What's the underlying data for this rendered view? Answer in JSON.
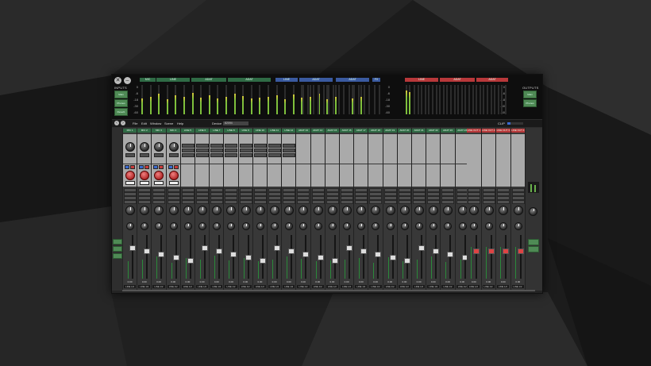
{
  "window": {
    "close_icon": "close-icon",
    "minimize_icon": "minimize-icon",
    "inputs_label": "INPUTS",
    "outputs_label": "OUTPUTS",
    "input_buttons": [
      "Main",
      "Phones",
      "Reverb"
    ],
    "output_buttons": [
      "Main",
      "Phones"
    ]
  },
  "meter_groups": {
    "inputs": [
      {
        "label": "MIC",
        "color": "#2f6b45"
      },
      {
        "label": "LINE",
        "color": "#2f6b45"
      },
      {
        "label": "ADAT",
        "color": "#2f6b45"
      },
      {
        "label": "ADAT",
        "color": "#2f6b45"
      },
      {
        "label": "LINE",
        "color": "#3a5aa0"
      },
      {
        "label": "ADAT",
        "color": "#3a5aa0"
      },
      {
        "label": "ADAT",
        "color": "#3a5aa0"
      },
      {
        "label": "FX",
        "color": "#3a5aa0"
      }
    ],
    "outputs": [
      {
        "label": "LINE",
        "color": "#b8383a"
      },
      {
        "label": "ADAT",
        "color": "#b8383a"
      },
      {
        "label": "ADAT",
        "color": "#b8383a"
      }
    ],
    "scale": [
      "0",
      "-6",
      "-18",
      "-30",
      "-60"
    ]
  },
  "menu": {
    "items": [
      "File",
      "Edit",
      "Window",
      "Scene",
      "Help"
    ],
    "device_label": "Device",
    "device_value": "82094",
    "clip_label": "CLIP"
  },
  "channels": {
    "inputs": [
      "MIC 1",
      "MIC 2",
      "MIC 3",
      "MIC 4",
      "LINE 5",
      "LINE 6",
      "LINE 7",
      "LINE 8",
      "LINE 9",
      "LINE 10",
      "LINE 11",
      "LINE 12",
      "ADAT 13",
      "ADAT 14",
      "ADAT 15",
      "ADAT 16",
      "ADAT 17",
      "ADAT 18",
      "ADAT 19",
      "ADAT 20",
      "ADAT 21",
      "ADAT 22",
      "ADAT 23",
      "ADAT 24"
    ],
    "outputs": [
      "LINE OUT 1",
      "LINE OUT 2",
      "LINE OUT 3",
      "LINE OUT 4"
    ],
    "input_values": [
      "0.00",
      "0.00",
      "0.00",
      "0.00",
      "0.00",
      "0.00",
      "0.00",
      "0.00",
      "0.00",
      "0.00",
      "0.00",
      "0.00",
      "0.00",
      "0.00",
      "0.00",
      "0.00",
      "0.00",
      "0.00",
      "0.00",
      "0.00",
      "0.00",
      "0.00",
      "0.00",
      "0.00"
    ],
    "output_values": [
      "0.00",
      "0.00",
      "0.00",
      "0.00"
    ],
    "route_label": "LINE 1/2"
  },
  "meter_levels": {
    "inputs": [
      0.55,
      0.6,
      0.7,
      0.5,
      0.65,
      0.6,
      0.72,
      0.58,
      0.66,
      0.55,
      0.6,
      0.7,
      0.62,
      0.55,
      0.58,
      0.6,
      0.64,
      0.5,
      0.68,
      0.56,
      0.6,
      0.7,
      0.52,
      0.6,
      0.65,
      0.55,
      0.6,
      0.5
    ],
    "outputs": [
      0.8,
      0.75
    ]
  },
  "colors": {
    "input_header": "#2f6b45",
    "adat_header": "#2f6b45",
    "output_header": "#b8383a",
    "meter_green": "#7ec03c",
    "meter_yellow": "#d8c83a"
  }
}
